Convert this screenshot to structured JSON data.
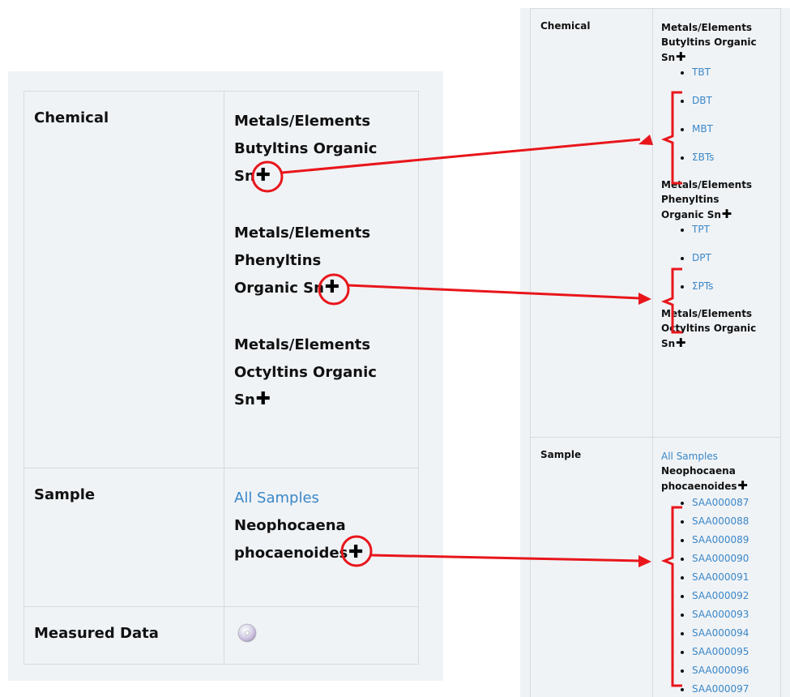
{
  "left": {
    "rows": [
      {
        "label": "Chemical",
        "groups": [
          {
            "line1": "Metals/Elements",
            "line2": "Butyltins Organic",
            "line3": "Sn"
          },
          {
            "line1": "Metals/Elements",
            "line2": "Phenyltins",
            "line3": "Organic Sn"
          },
          {
            "line1": "Metals/Elements",
            "line2": "Octyltins Organic",
            "line3": "Sn"
          }
        ]
      },
      {
        "label": "Sample",
        "all_samples": "All Samples",
        "species1": "Neophocaena",
        "species2": "phocaenoides"
      },
      {
        "label": "Measured Data"
      }
    ]
  },
  "right": {
    "chemical_label": "Chemical",
    "butyl": {
      "line1": "Metals/Elements",
      "line2": "Butyltins Organic",
      "line3": "Sn",
      "items": [
        "TBT",
        "DBT",
        "MBT",
        "ΣBTs"
      ]
    },
    "phenyl": {
      "line1": "Metals/Elements",
      "line2": "Phenyltins",
      "line3": "Organic Sn",
      "items": [
        "TPT",
        "DPT",
        "ΣPTs"
      ]
    },
    "octyl": {
      "line1": "Metals/Elements",
      "line2": "Octyltins Organic",
      "line3": "Sn"
    },
    "sample_label": "Sample",
    "all_samples": "All Samples",
    "species1": "Neophocaena",
    "species2": "phocaenoides",
    "samples": [
      "SAA000087",
      "SAA000088",
      "SAA000089",
      "SAA000090",
      "SAA000091",
      "SAA000092",
      "SAA000093",
      "SAA000094",
      "SAA000095",
      "SAA000096",
      "SAA000097"
    ]
  },
  "colors": {
    "link": "#3a87c8",
    "annotation": "#e8161b",
    "panel": "#f0f3f6"
  },
  "icons": {
    "expand": "plus-icon",
    "data": "disc-icon"
  }
}
